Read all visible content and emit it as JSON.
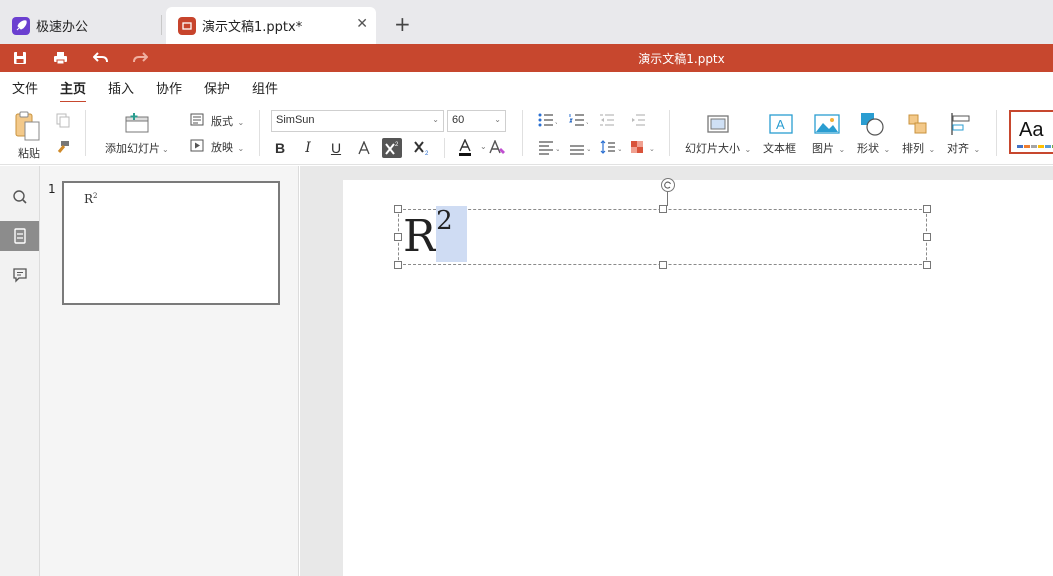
{
  "tabs": {
    "app_tab": "极速办公",
    "doc_tab": "演示文稿1.pptx*"
  },
  "titlebar": {
    "title": "演示文稿1.pptx"
  },
  "menu": {
    "items": [
      "文件",
      "主页",
      "插入",
      "协作",
      "保护",
      "组件"
    ],
    "active": "主页"
  },
  "ribbon": {
    "paste_label": "粘贴",
    "add_slide_label": "添加幻灯片",
    "layout_label": "版式",
    "play_label": "放映",
    "font_name": "SimSun",
    "font_size": "60",
    "slide_size_label": "幻灯片大小",
    "textbox_label": "文本框",
    "picture_label": "图片",
    "shape_label": "形状",
    "arrange_label": "排列",
    "align_label": "对齐",
    "theme_preview": "Aa"
  },
  "thumbnails": [
    {
      "number": "1",
      "text": "R",
      "sup": "2"
    }
  ],
  "slide": {
    "text": "R",
    "superscript": "2"
  },
  "colors": {
    "accent": "#c7472e",
    "selection": "#cfdcf3"
  }
}
